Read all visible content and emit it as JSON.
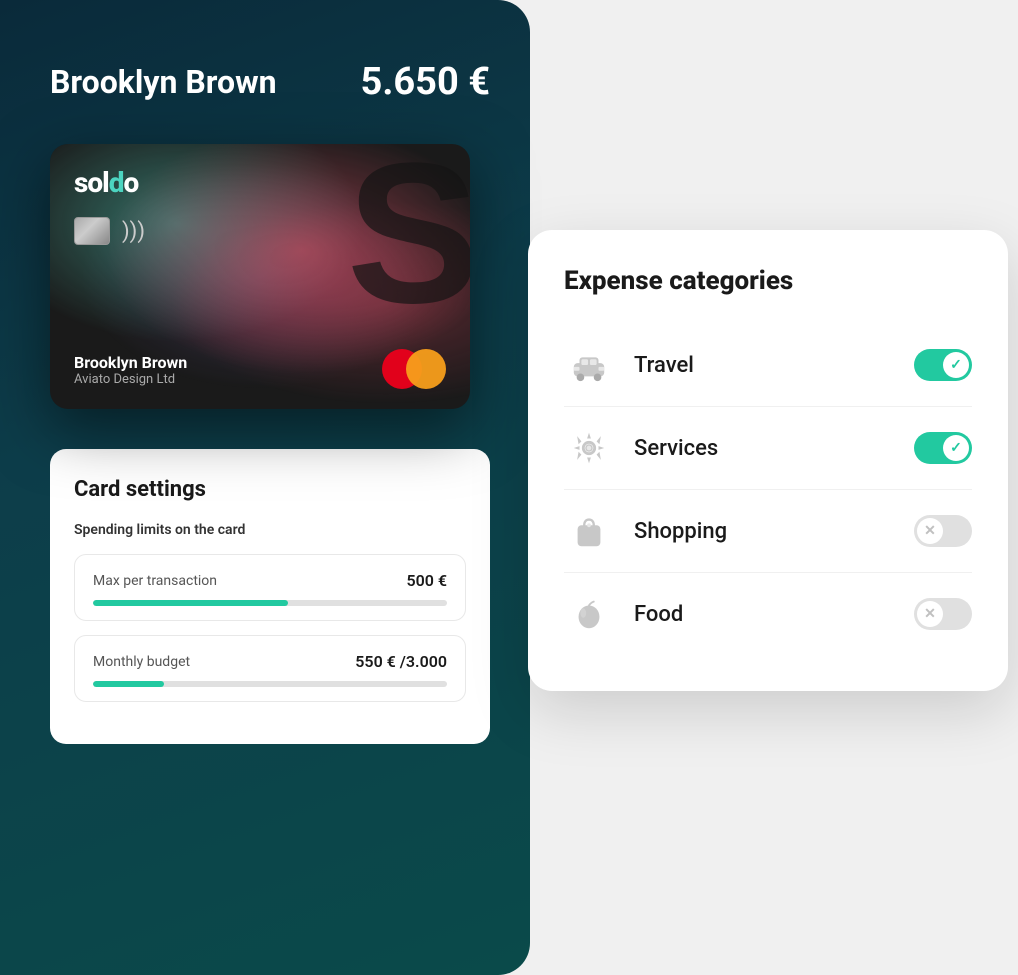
{
  "header": {
    "cardholder_name": "Brooklyn Brown",
    "balance": "5.650 €"
  },
  "credit_card": {
    "logo": "soldo",
    "card_name": "Brooklyn Brown",
    "card_company": "Aviato Design Ltd",
    "big_letter": "S"
  },
  "card_settings": {
    "title": "Card settings",
    "spending_limits_label": "Spending limits on the card",
    "limits": [
      {
        "label": "Max per transaction",
        "value": "500 €",
        "progress_pct": 55
      },
      {
        "label": "Monthly budget",
        "value": "550 € /3.000",
        "progress_pct": 20
      }
    ]
  },
  "expense_categories": {
    "title": "Expense categories",
    "categories": [
      {
        "name": "Travel",
        "icon": "travel-icon",
        "enabled": true
      },
      {
        "name": "Services",
        "icon": "services-icon",
        "enabled": true
      },
      {
        "name": "Shopping",
        "icon": "shopping-icon",
        "enabled": false
      },
      {
        "name": "Food",
        "icon": "food-icon",
        "enabled": false
      }
    ]
  }
}
